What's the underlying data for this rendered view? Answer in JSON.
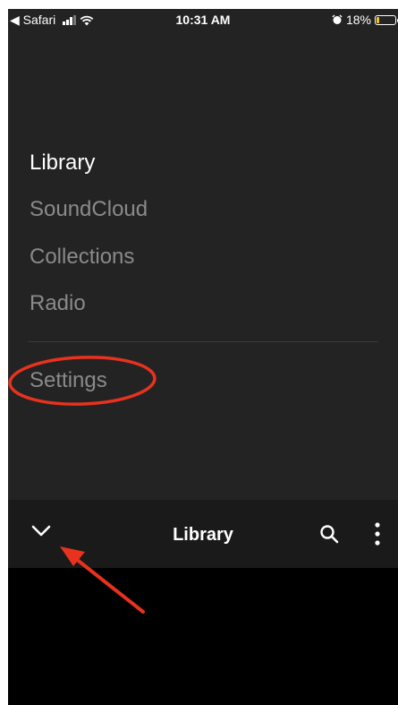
{
  "status_bar": {
    "back_app": "◀ Safari",
    "time": "10:31 AM",
    "battery_percent": "18%",
    "battery_level": 0.18,
    "icons": [
      "signal-icon",
      "wifi-icon",
      "alarm-icon",
      "battery-icon"
    ]
  },
  "menu": {
    "items": [
      {
        "label": "Library",
        "active": true
      },
      {
        "label": "SoundCloud",
        "active": false
      },
      {
        "label": "Collections",
        "active": false
      },
      {
        "label": "Radio",
        "active": false
      }
    ],
    "settings_label": "Settings"
  },
  "toolbar": {
    "title": "Library",
    "icons": [
      "chevron-down-icon",
      "search-icon",
      "more-vertical-icon"
    ]
  },
  "colors": {
    "panel_bg": "#232323",
    "active_text": "#ffffff",
    "inactive_text": "#8a8a8a",
    "annotation": "#e8321e"
  }
}
